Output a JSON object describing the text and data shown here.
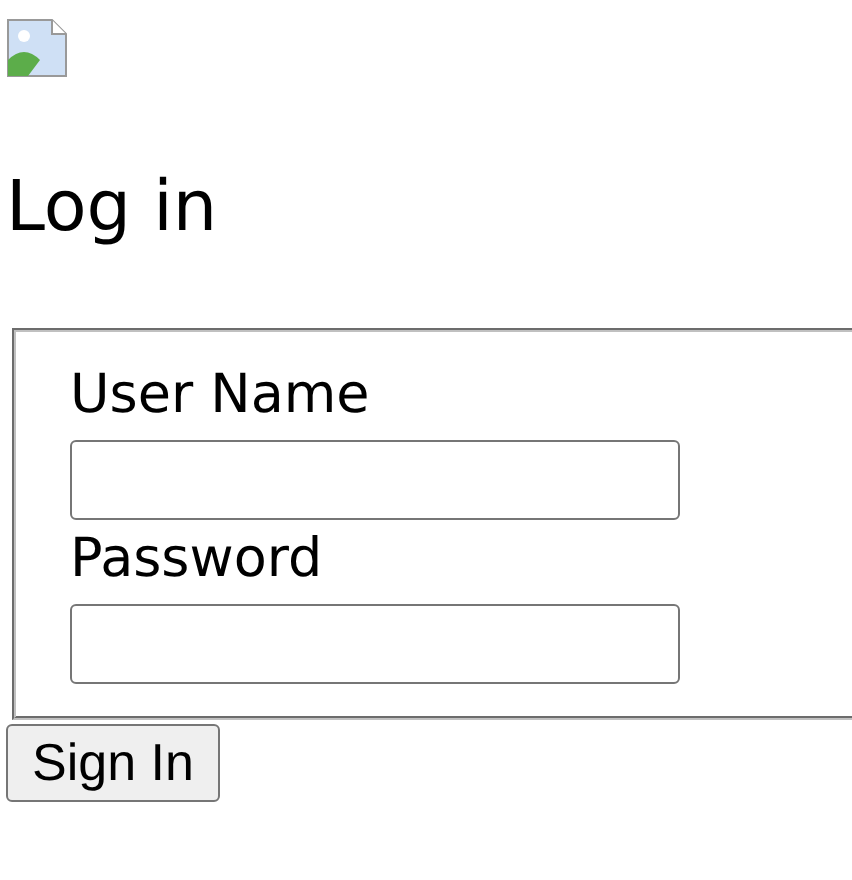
{
  "title": "Log in",
  "fields": [
    {
      "label": "User Name"
    },
    {
      "label": "Password"
    }
  ],
  "submit": {
    "label": "Sign In"
  }
}
